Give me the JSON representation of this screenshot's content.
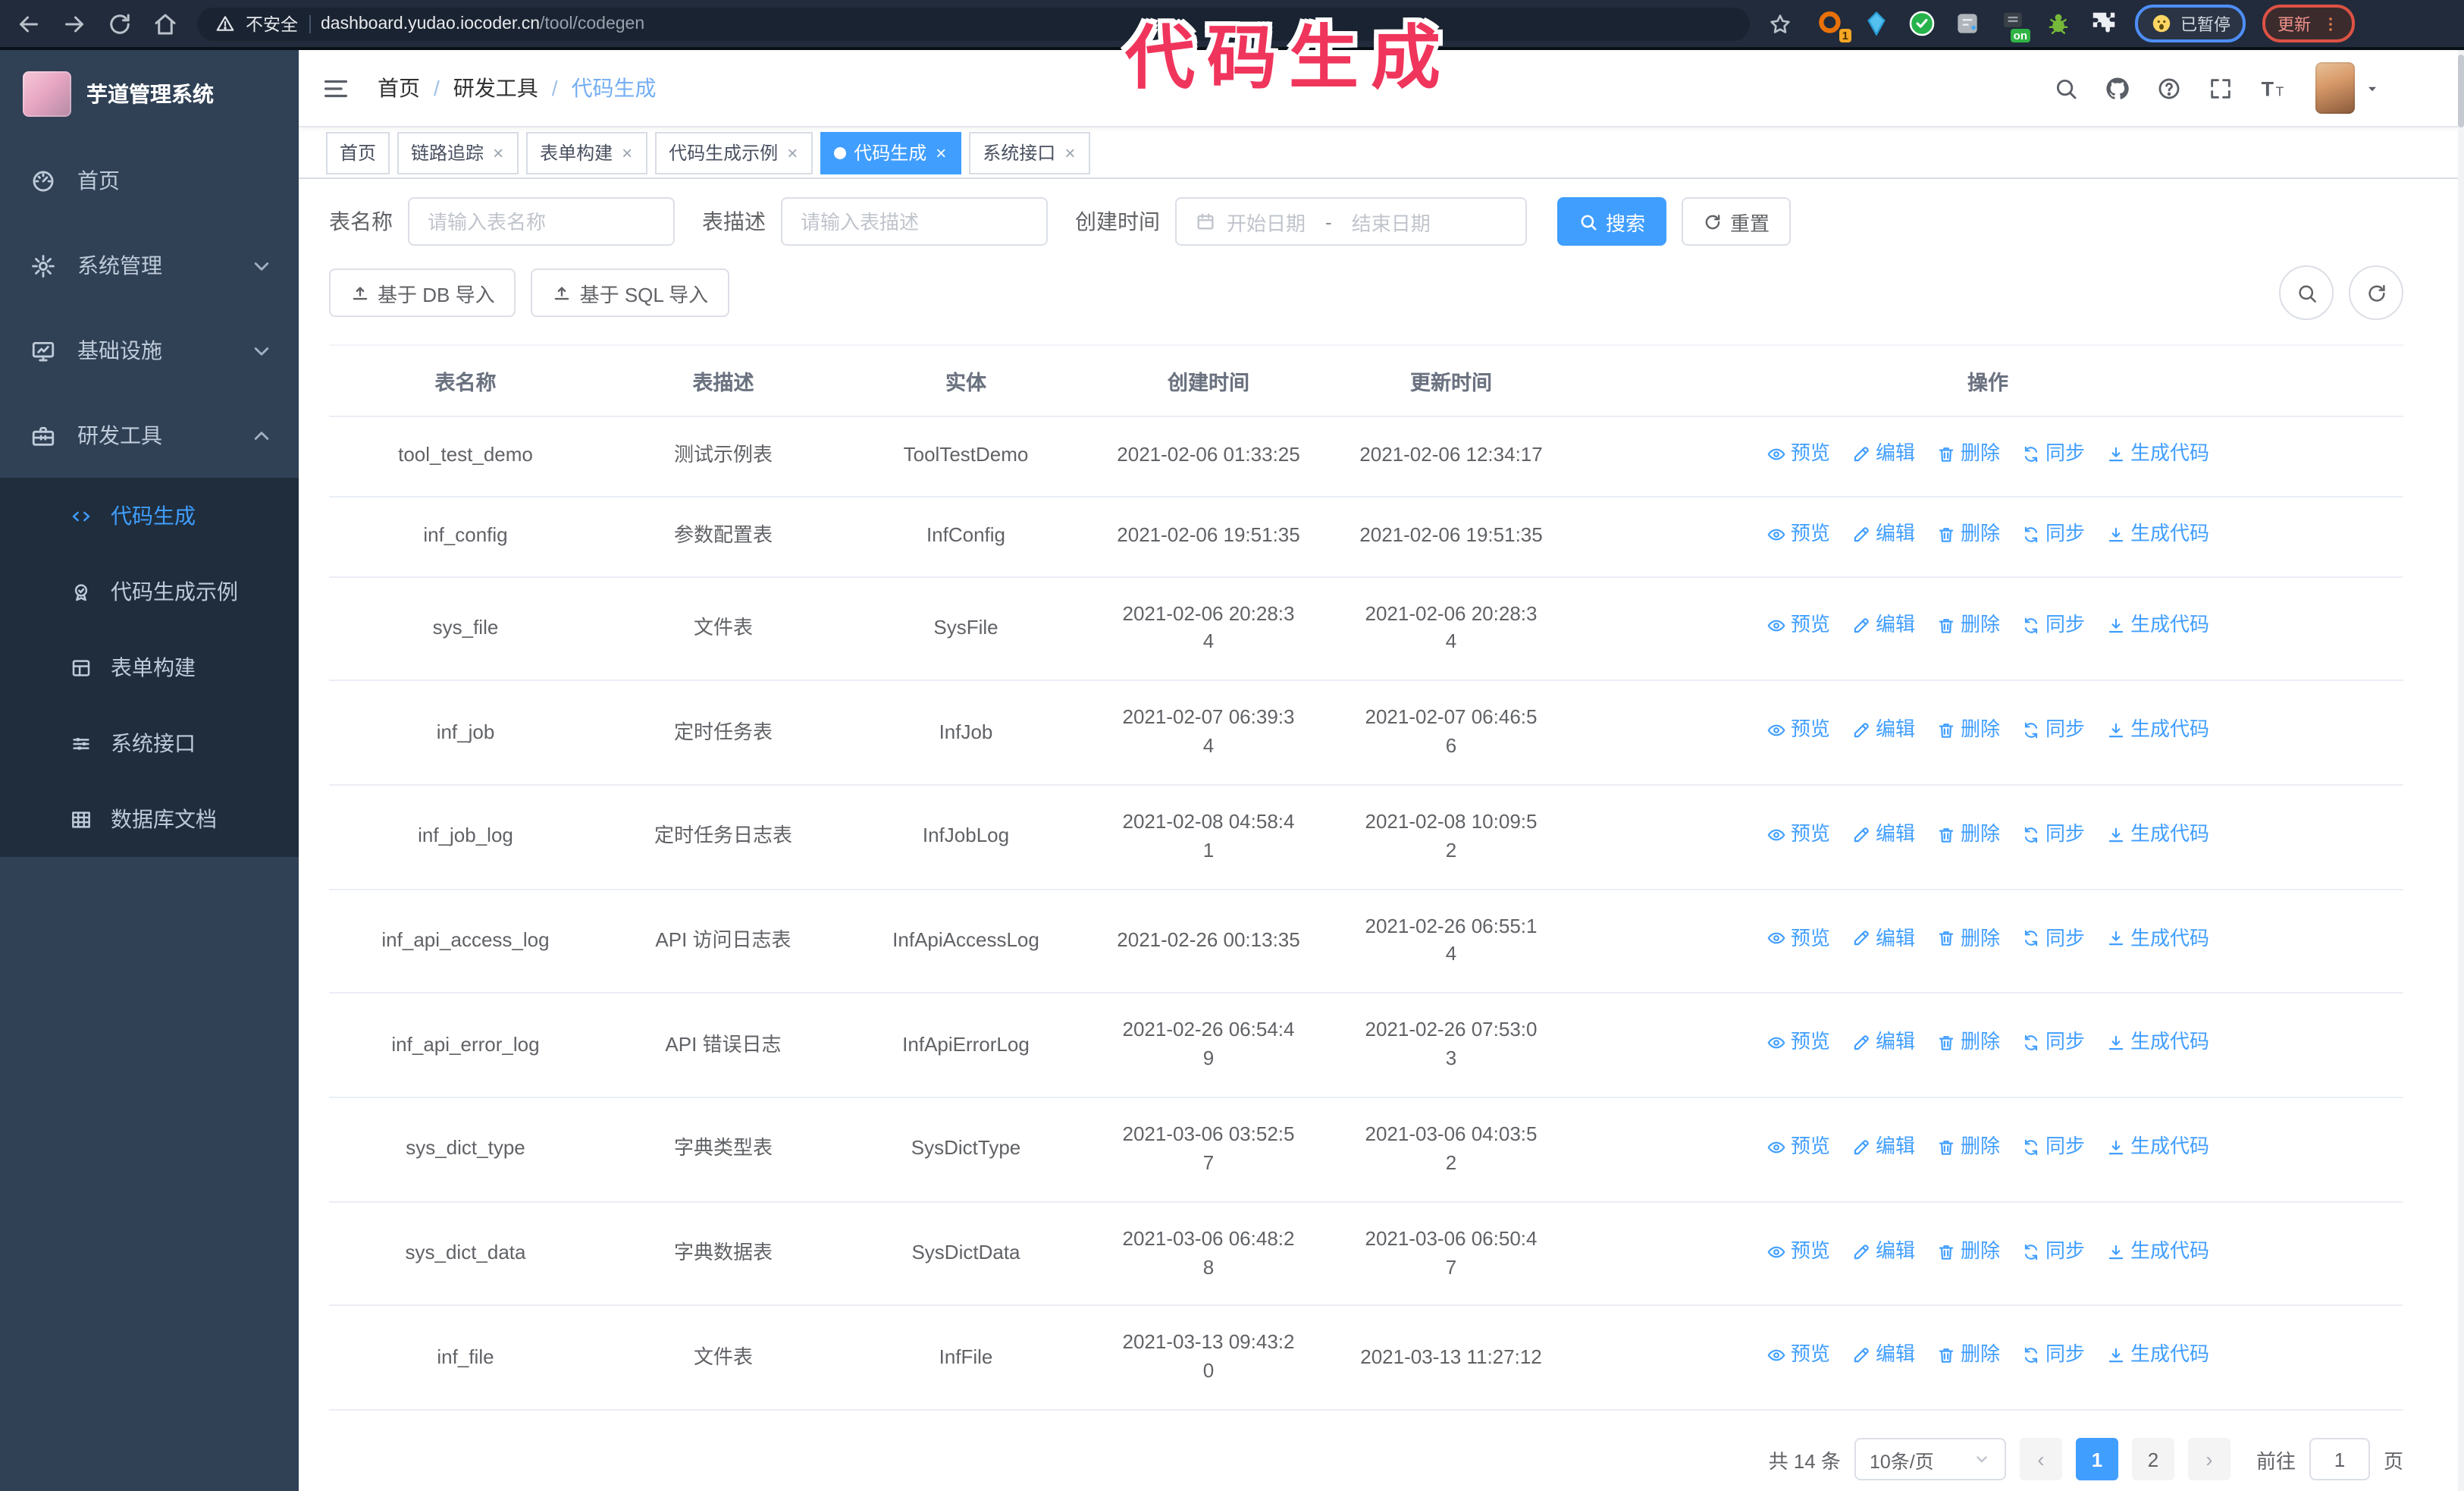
{
  "colors": {
    "accent": "#409eff",
    "sidebar_bg": "#304156",
    "submenu_bg": "#1f2d3d",
    "annotation": "#f0355c"
  },
  "browser": {
    "security_label": "不安全",
    "url_host": "dashboard.yudao.iocoder.cn",
    "url_path": "/tool/codegen",
    "extension_badge": "1",
    "extension_on_badge": "on",
    "paused_label": "已暂停",
    "update_label": "更新"
  },
  "annotation": {
    "text": "代码生成"
  },
  "sidebar": {
    "title": "芋道管理系统",
    "items": [
      {
        "label": "首页",
        "icon": "dashboard-icon"
      },
      {
        "label": "系统管理",
        "icon": "gear-icon",
        "chevron": "down"
      },
      {
        "label": "基础设施",
        "icon": "monitor-icon",
        "chevron": "down"
      },
      {
        "label": "研发工具",
        "icon": "toolbox-icon",
        "chevron": "up",
        "expanded": true,
        "children": [
          {
            "label": "代码生成",
            "icon": "code-icon",
            "active": true
          },
          {
            "label": "代码生成示例",
            "icon": "badge-check-icon"
          },
          {
            "label": "表单构建",
            "icon": "form-icon"
          },
          {
            "label": "系统接口",
            "icon": "sliders-icon"
          },
          {
            "label": "数据库文档",
            "icon": "db-table-icon"
          }
        ]
      }
    ]
  },
  "breadcrumb": {
    "items": [
      "首页",
      "研发工具",
      "代码生成"
    ],
    "separator": "/"
  },
  "tabs": [
    {
      "label": "首页",
      "closable": false,
      "active": false
    },
    {
      "label": "链路追踪",
      "closable": true,
      "active": false
    },
    {
      "label": "表单构建",
      "closable": true,
      "active": false
    },
    {
      "label": "代码生成示例",
      "closable": true,
      "active": false
    },
    {
      "label": "代码生成",
      "closable": true,
      "active": true
    },
    {
      "label": "系统接口",
      "closable": true,
      "active": false
    }
  ],
  "filters": {
    "table_name_label": "表名称",
    "table_name_placeholder": "请输入表名称",
    "table_desc_label": "表描述",
    "table_desc_placeholder": "请输入表描述",
    "create_time_label": "创建时间",
    "date_start_placeholder": "开始日期",
    "date_separator": "-",
    "date_end_placeholder": "结束日期",
    "search_label": "搜索",
    "reset_label": "重置"
  },
  "toolbar": {
    "import_db_label": "基于 DB 导入",
    "import_sql_label": "基于 SQL 导入"
  },
  "table": {
    "columns": [
      "表名称",
      "表描述",
      "实体",
      "创建时间",
      "更新时间",
      "操作"
    ],
    "actions": [
      {
        "name": "preview",
        "label": "预览",
        "icon": "eye-icon"
      },
      {
        "name": "edit",
        "label": "编辑",
        "icon": "edit-icon"
      },
      {
        "name": "delete",
        "label": "删除",
        "icon": "delete-icon"
      },
      {
        "name": "sync",
        "label": "同步",
        "icon": "sync-icon"
      },
      {
        "name": "generate-code",
        "label": "生成代码",
        "icon": "download-icon"
      }
    ],
    "rows": [
      {
        "name": "tool_test_demo",
        "desc": "测试示例表",
        "entity": "ToolTestDemo",
        "created": "2021-02-06 01:33:25",
        "updated": "2021-02-06 12:34:17"
      },
      {
        "name": "inf_config",
        "desc": "参数配置表",
        "entity": "InfConfig",
        "created": "2021-02-06 19:51:35",
        "updated": "2021-02-06 19:51:35"
      },
      {
        "name": "sys_file",
        "desc": "文件表",
        "entity": "SysFile",
        "created": "2021-02-06 20:28:3\n4",
        "updated": "2021-02-06 20:28:3\n4"
      },
      {
        "name": "inf_job",
        "desc": "定时任务表",
        "entity": "InfJob",
        "created": "2021-02-07 06:39:3\n4",
        "updated": "2021-02-07 06:46:5\n6"
      },
      {
        "name": "inf_job_log",
        "desc": "定时任务日志表",
        "entity": "InfJobLog",
        "created": "2021-02-08 04:58:4\n1",
        "updated": "2021-02-08 10:09:5\n2"
      },
      {
        "name": "inf_api_access_log",
        "desc": "API 访问日志表",
        "entity": "InfApiAccessLog",
        "created": "2021-02-26 00:13:35",
        "updated": "2021-02-26 06:55:1\n4"
      },
      {
        "name": "inf_api_error_log",
        "desc": "API 错误日志",
        "entity": "InfApiErrorLog",
        "created": "2021-02-26 06:54:4\n9",
        "updated": "2021-02-26 07:53:0\n3"
      },
      {
        "name": "sys_dict_type",
        "desc": "字典类型表",
        "entity": "SysDictType",
        "created": "2021-03-06 03:52:5\n7",
        "updated": "2021-03-06 04:03:5\n2"
      },
      {
        "name": "sys_dict_data",
        "desc": "字典数据表",
        "entity": "SysDictData",
        "created": "2021-03-06 06:48:2\n8",
        "updated": "2021-03-06 06:50:4\n7"
      },
      {
        "name": "inf_file",
        "desc": "文件表",
        "entity": "InfFile",
        "created": "2021-03-13 09:43:2\n0",
        "updated": "2021-03-13 11:27:12"
      }
    ]
  },
  "pagination": {
    "total_label": "共 14 条",
    "page_size_label": "10条/页",
    "pages": [
      "1",
      "2"
    ],
    "active_page": "1",
    "goto_label": "前往",
    "goto_value": "1",
    "unit_label": "页"
  }
}
